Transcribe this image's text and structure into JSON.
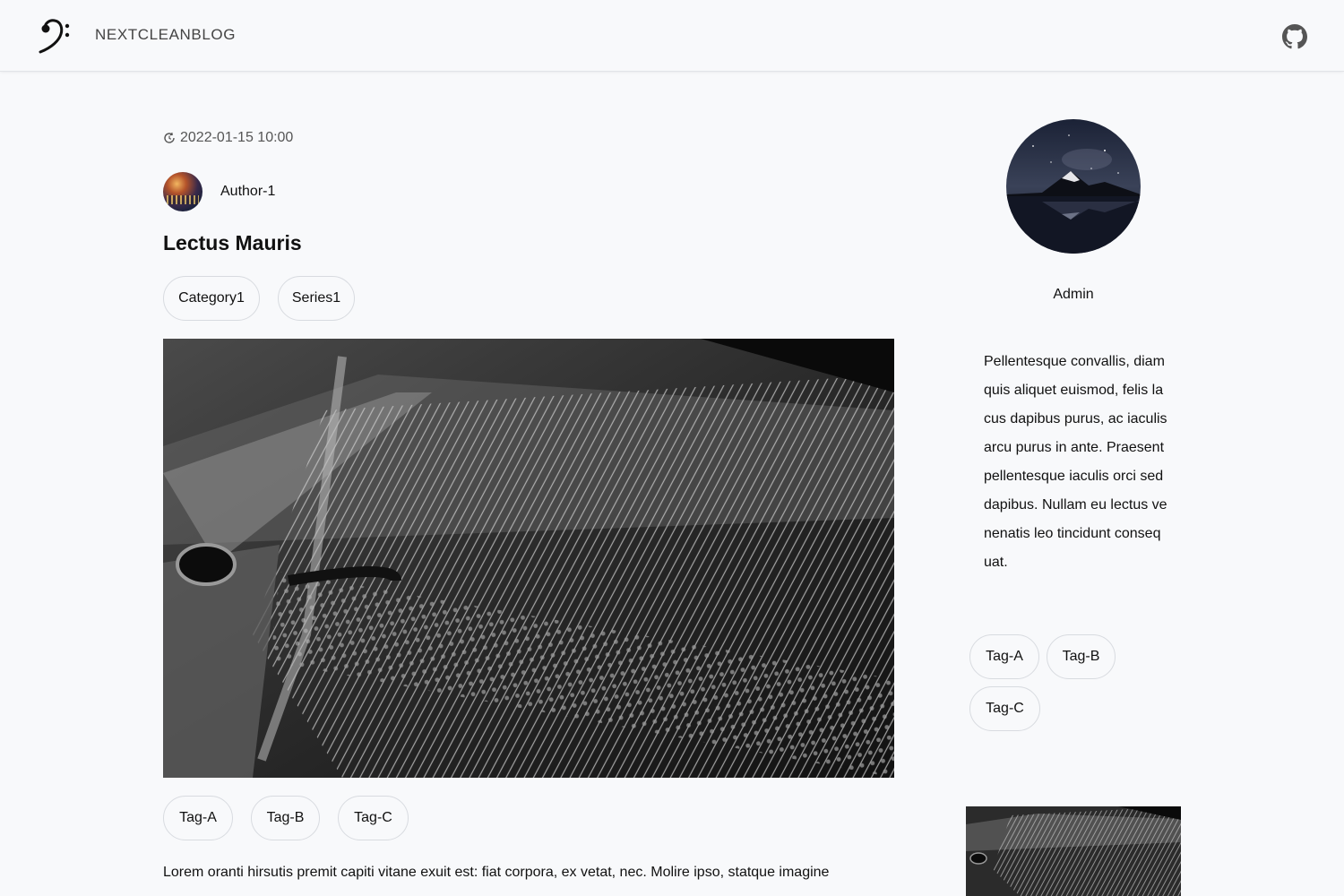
{
  "header": {
    "brand": "NEXTCLEANBLOG",
    "logo_icon": "bass-clef-icon",
    "github_icon": "github-icon"
  },
  "post": {
    "date": "2022-01-15 10:00",
    "date_icon": "clock-icon",
    "author": "Author-1",
    "title": "Lectus Mauris",
    "category": "Category1",
    "series": "Series1",
    "tags": [
      "Tag-A",
      "Tag-B",
      "Tag-C"
    ],
    "body_first_line": "Lorem oranti hirsutis premit capiti vitane exuit est: fiat corpora, ex vetat, nec. Molire ipso, statque imagine"
  },
  "sidebar": {
    "name": "Admin",
    "bio": "Pellentesque convallis, diam quis aliquet euismod, felis lacus dapibus purus, ac iaculis arcu purus in ante. Praesent pellentesque iaculis orci sed dapibus. Nullam eu lectus venenatis leo tincidunt consequat.",
    "tags": [
      "Tag-A",
      "Tag-B",
      "Tag-C"
    ]
  },
  "colors": {
    "background": "#f8f9fb",
    "border": "#d8dbe0",
    "text": "#111111"
  }
}
